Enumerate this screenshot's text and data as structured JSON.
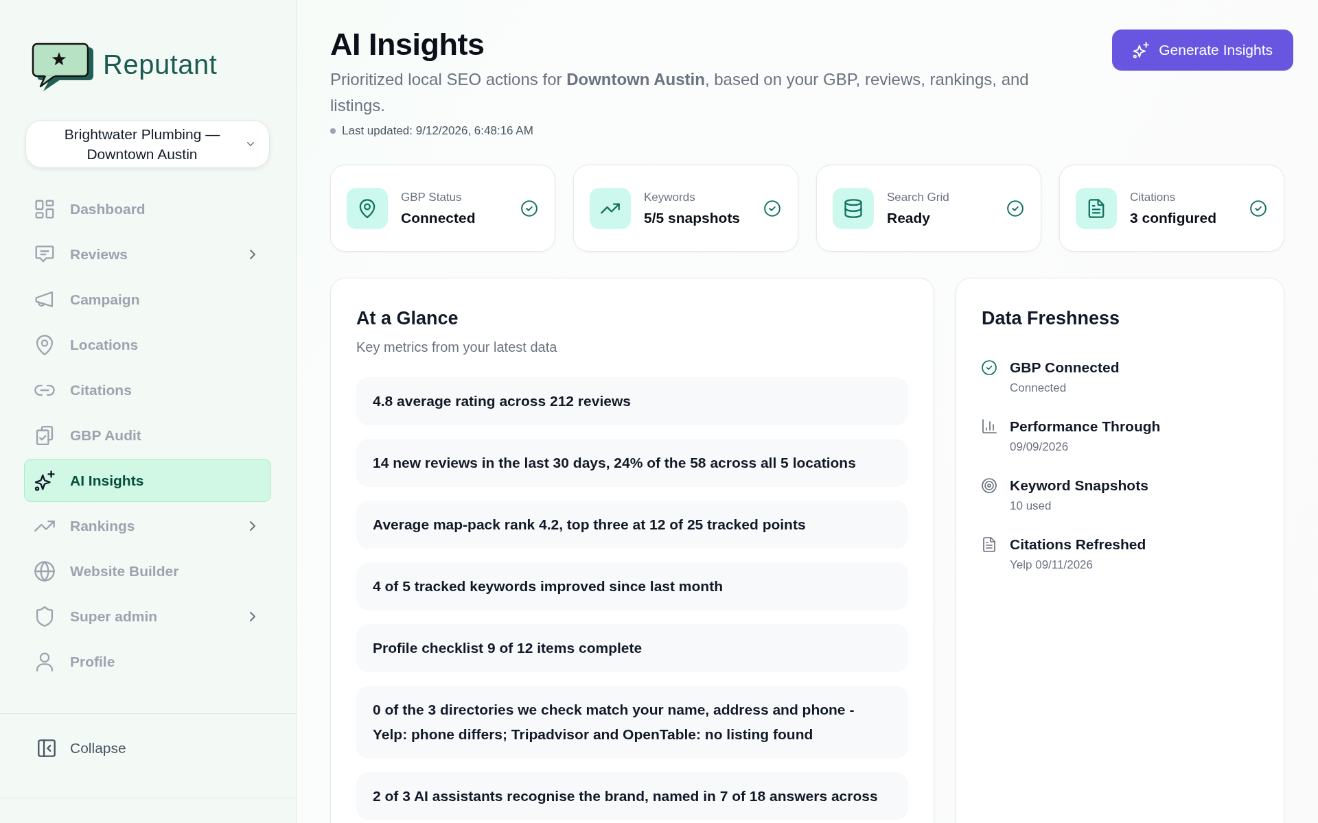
{
  "sidebar": {
    "brand": "Reputant",
    "location_select": {
      "value": "Brightwater Plumbing — Downtown Austin"
    },
    "items": [
      {
        "label": "Dashboard",
        "selected": false,
        "has_submenu": false
      },
      {
        "label": "Reviews",
        "selected": false,
        "has_submenu": true
      },
      {
        "label": "Campaign",
        "selected": false,
        "has_submenu": false
      },
      {
        "label": "Locations",
        "selected": false,
        "has_submenu": false
      },
      {
        "label": "Citations",
        "selected": false,
        "has_submenu": false
      },
      {
        "label": "GBP Audit",
        "selected": false,
        "has_submenu": false
      },
      {
        "label": "AI Insights",
        "selected": true,
        "has_submenu": false
      },
      {
        "label": "Rankings",
        "selected": false,
        "has_submenu": true
      },
      {
        "label": "Website Builder",
        "selected": false,
        "has_submenu": false
      },
      {
        "label": "Super admin",
        "selected": false,
        "has_submenu": true
      },
      {
        "label": "Profile",
        "selected": false,
        "has_submenu": false
      }
    ],
    "collapse": {
      "label": "Collapse"
    }
  },
  "header": {
    "title": "AI Insights",
    "subtitle": "Prioritized local SEO actions for **Downtown Austin**, based on your GBP, reviews, rankings, and listings.",
    "last_updated": "Last updated: 9/12/2026, 6:48:16 AM",
    "generate_button": {
      "label": "Generate Insights"
    }
  },
  "stats": [
    {
      "label": "GBP Status",
      "value": "Connected",
      "ok": true
    },
    {
      "label": "Keywords",
      "value": "5/5 snapshots",
      "ok": true
    },
    {
      "label": "Search Grid",
      "value": "Ready",
      "ok": true
    },
    {
      "label": "Citations",
      "value": "3 configured",
      "ok": true
    }
  ],
  "at_a_glance": {
    "title": "At a Glance",
    "subtitle": "Key metrics from your latest data",
    "items": [
      "4.8 average rating across 212 reviews",
      "14 new reviews in the last 30 days, 24% of the 58 across all 5 locations",
      "Average map-pack rank 4.2, top three at 12 of 25 tracked points",
      "4 of 5 tracked keywords improved since last month",
      "Profile checklist 9 of 12 items complete",
      "0 of the 3 directories we check match your name, address and phone - Yelp: phone differs; Tripadvisor and OpenTable: no listing found",
      "2 of 3 AI assistants recognise the brand, named in 7 of 18 answers across"
    ]
  },
  "data_freshness": {
    "title": "Data Freshness",
    "items": [
      {
        "title": "GBP Connected",
        "detail": "Connected"
      },
      {
        "title": "Performance Through",
        "detail": "09/09/2026"
      },
      {
        "title": "Keyword Snapshots",
        "detail": "10 used"
      },
      {
        "title": "Citations Refreshed",
        "detail": "Yelp 09/11/2026"
      }
    ]
  }
}
